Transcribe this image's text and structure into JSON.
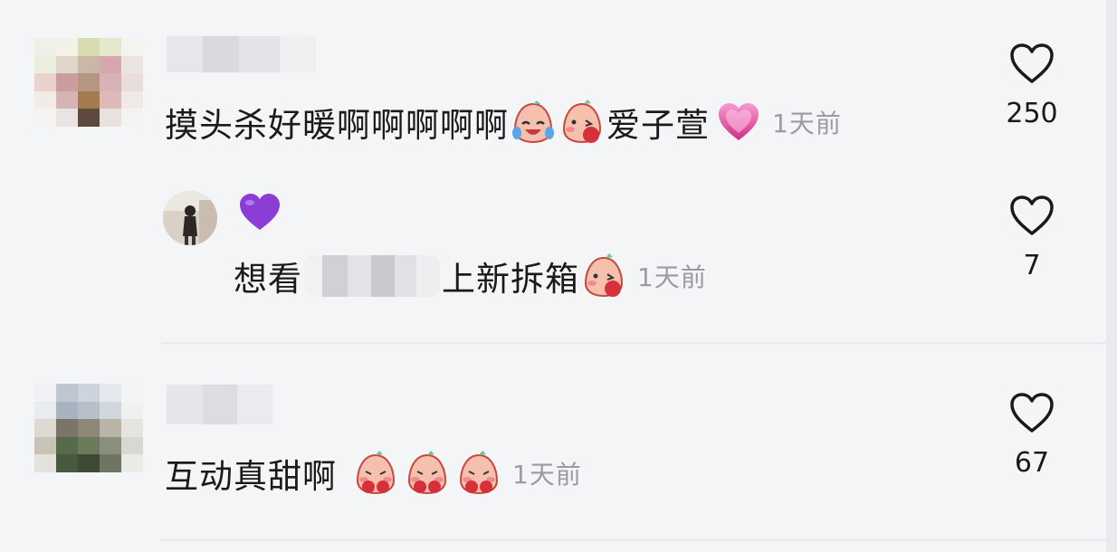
{
  "comments": [
    {
      "text": "摸头杀好暖啊啊啊啊啊",
      "text_after": "爱子萱",
      "time": "1天前",
      "likes": "250",
      "emojis_before": [
        "crying-laughing-peach-emoji",
        "blushing-peach-emoji"
      ],
      "emoji_after": "pink-heart-emoji"
    },
    {
      "reply": true,
      "name_badge": "purple-heart-emoji",
      "text_before": "想看",
      "text_after": "上新拆箱",
      "time": "1天前",
      "likes": "7",
      "emoji": "blushing-peach-emoji"
    },
    {
      "text": "互动真甜啊",
      "time": "1天前",
      "likes": "67",
      "emojis": [
        "shy-peach-emoji",
        "shy-peach-emoji",
        "shy-peach-emoji"
      ]
    }
  ],
  "colors": {
    "background": "#f4f5f7",
    "time_text": "#9a9ca3",
    "pink_heart": "#e84fa1",
    "purple_heart": "#8b3dd6",
    "peach": "#f6c0ae"
  }
}
